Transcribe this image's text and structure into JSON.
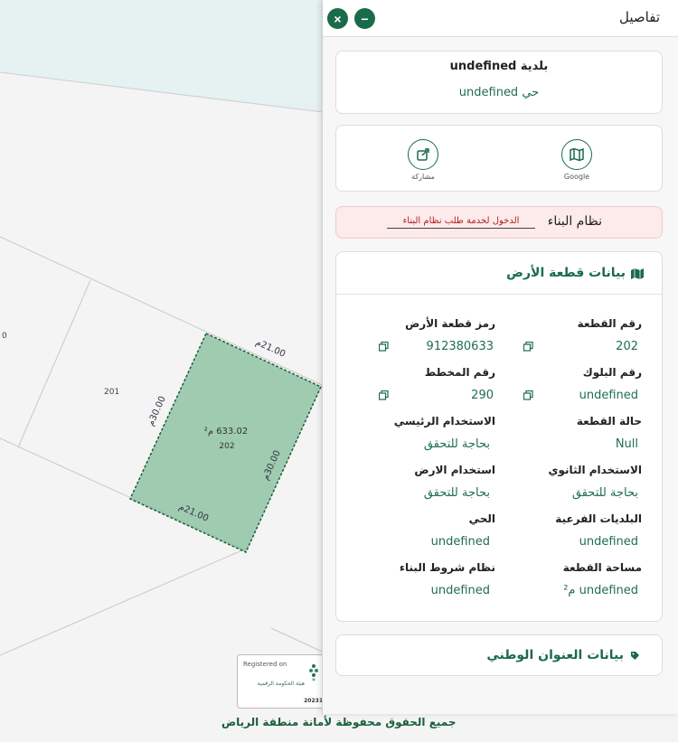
{
  "map": {
    "parcels": {
      "main": {
        "number": "202",
        "area": "633.02 م²"
      },
      "neighbor": {
        "number": "201"
      },
      "partial_edge_label": "0"
    },
    "dimensions": {
      "top": "21.00م",
      "left": "30.00م",
      "right": "30.00م",
      "bottom": "21.00م"
    },
    "registration": {
      "label": "Registered on",
      "org": "هيئة الحكومة الرقمية",
      "number": "20231"
    },
    "copyright": "جميع الحقوق محفوظة لأمانة منطقة الرياض",
    "colors": {
      "parcel_fill": "#8fc4a3",
      "parcel_stroke": "#1b5e3c"
    }
  },
  "panel": {
    "title": "تفاصيل",
    "close_icon": "×",
    "minimize_icon": "−",
    "municipality": "بلدية undefined",
    "neighborhood": "حي undefined",
    "actions": {
      "google_label": "Google",
      "share_label": "مشاركة"
    },
    "building_system": {
      "title": "نظام البناء",
      "link": "الدخول لخدمة طلب نظام البناء"
    },
    "land": {
      "title": "بيانات قطعة الأرض",
      "fields": {
        "plot_number": {
          "label": "رقم القطعة",
          "value": "202"
        },
        "plot_code": {
          "label": "رمز قطعة الأرض",
          "value": "912380633"
        },
        "block_number": {
          "label": "رقم البلوك",
          "value": "undefined"
        },
        "plan_number": {
          "label": "رقم المخطط",
          "value": "290"
        },
        "plot_status": {
          "label": "حالة القطعة",
          "value": "Null"
        },
        "main_use": {
          "label": "الاستخدام الرئيسي",
          "value": "بحاجة للتحقق"
        },
        "secondary_use": {
          "label": "الاستخدام الثانوي",
          "value": "بحاجة للتحقق"
        },
        "land_use": {
          "label": "استخدام الارض",
          "value": "بحاجة للتحقق"
        },
        "sub_municipality": {
          "label": "البلديات الفرعية",
          "value": "undefined"
        },
        "district": {
          "label": "الحي",
          "value": "undefined"
        },
        "plot_area": {
          "label": "مساحة القطعة",
          "value": "undefined م²"
        },
        "building_conditions": {
          "label": "نظام شروط البناء",
          "value": "undefined"
        }
      }
    },
    "national_address": {
      "title": "بيانات العنوان الوطني"
    },
    "accent_color": "#1a6b4a"
  }
}
